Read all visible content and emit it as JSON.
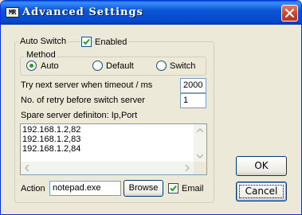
{
  "window": {
    "app_icon_text": "MR",
    "title": "Advanced Settings"
  },
  "auto_switch": {
    "label": "Auto Switch",
    "enabled_label": "Enabled",
    "enabled_checked": true
  },
  "method": {
    "label": "Method",
    "options": [
      "Auto",
      "Default",
      "Switch"
    ],
    "selected": "Auto"
  },
  "settings": {
    "timeout_label": "Try next server when timeout / ms",
    "timeout_value": "2000",
    "retry_label": "No. of retry before switch server",
    "retry_value": "1",
    "spare_label": "Spare server definiton: Ip,Port",
    "spare_servers": [
      "192.168.1.2,82",
      "192.168.1.2,83",
      "192.168.1.2,84"
    ]
  },
  "action": {
    "label": "Action",
    "value": "notepad.exe",
    "browse_label": "Browse",
    "email_label": "Email",
    "email_checked": true
  },
  "buttons": {
    "ok_label": "OK",
    "cancel_label": "Cancel"
  }
}
